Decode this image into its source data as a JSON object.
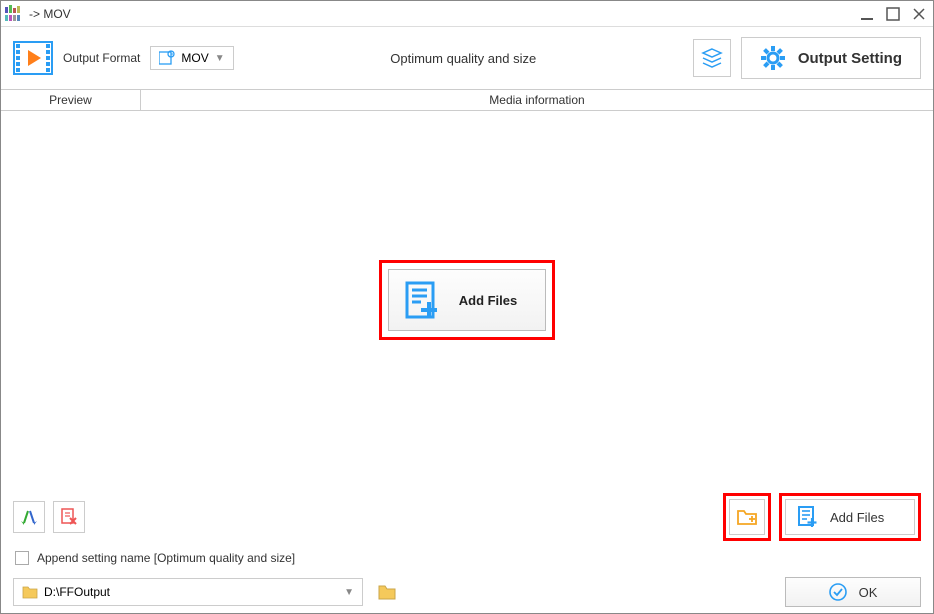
{
  "window": {
    "title": "-> MOV"
  },
  "toolbar": {
    "output_format_label": "Output Format",
    "format_value": "MOV",
    "quality_text": "Optimum quality and size",
    "output_setting_label": "Output Setting"
  },
  "columns": {
    "preview": "Preview",
    "media_info": "Media information"
  },
  "main": {
    "add_files_label": "Add Files"
  },
  "bottom": {
    "add_files_label": "Add Files"
  },
  "checkbox": {
    "label": "Append setting name [Optimum quality and size]"
  },
  "output": {
    "path": "D:\\FFOutput",
    "ok_label": "OK"
  }
}
